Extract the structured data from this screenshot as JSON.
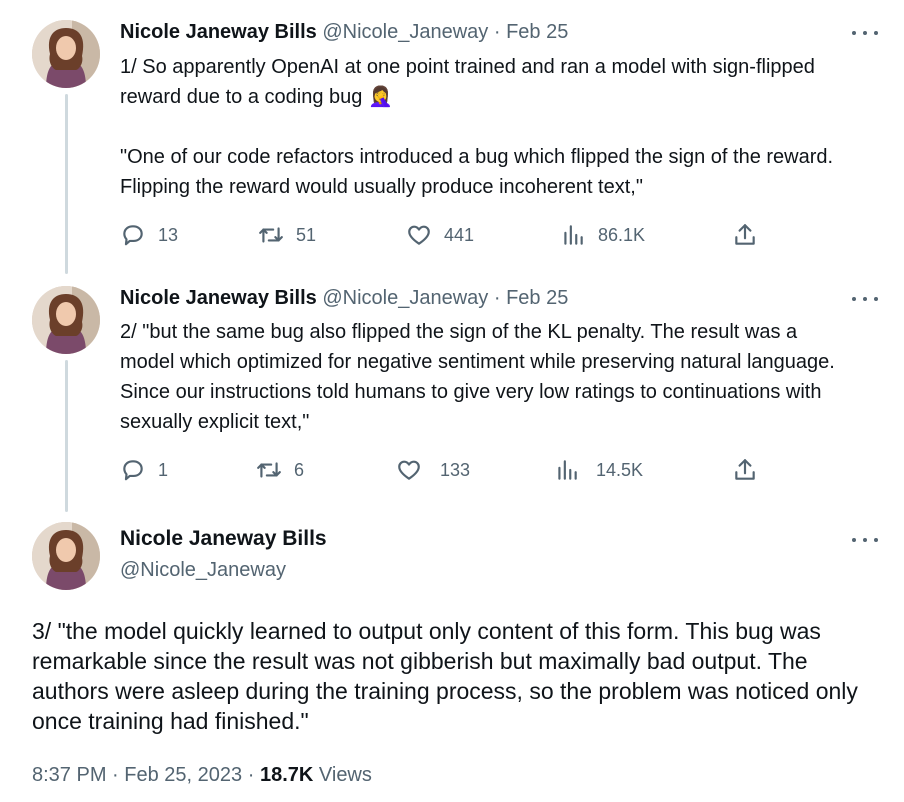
{
  "tweets": [
    {
      "name": "Nicole Janeway Bills",
      "handle": "@Nicole_Janeway",
      "separator": "·",
      "date": "Feb 25",
      "text_line_1": "1/  So apparently OpenAI at one point trained and ran a model with sign-flipped reward due to a coding bug 🤦‍♀️",
      "text_line_2": "\"One of our code refactors introduced a bug which flipped the sign of the reward. Flipping the reward would usually produce incoherent text,\"",
      "replies": "13",
      "retweets": "51",
      "likes": "441",
      "views": "86.1K"
    },
    {
      "name": "Nicole Janeway Bills",
      "handle": "@Nicole_Janeway",
      "separator": "·",
      "date": "Feb 25",
      "text_line_1": "2/ \"but the same bug also flipped the sign of the KL penalty. The result was a model which optimized for negative sentiment while preserving natural language. Since our instructions told humans to give very low ratings to continuations with sexually explicit text,\"",
      "replies": "1",
      "retweets": "6",
      "likes": "133",
      "views": "14.5K"
    }
  ],
  "main": {
    "name": "Nicole Janeway Bills",
    "handle": "@Nicole_Janeway",
    "text": "3/  \"the model quickly learned to output only content of this form. This bug was remarkable since the result was not gibberish but maximally bad output. The authors were asleep during the training process, so the problem was noticed only once training had finished.\"",
    "time": "8:37 PM",
    "separator": "·",
    "date": "Feb 25, 2023",
    "separator2": "·",
    "views_count": "18.7K",
    "views_label": "Views"
  },
  "icons": {
    "reply": "reply-icon",
    "retweet": "retweet-icon",
    "like": "heart-icon",
    "views": "views-icon",
    "share": "share-icon",
    "more": "more-icon"
  },
  "colors": {
    "text": "#0f1419",
    "secondary": "#536471",
    "thread_line": "#cfd9de"
  }
}
